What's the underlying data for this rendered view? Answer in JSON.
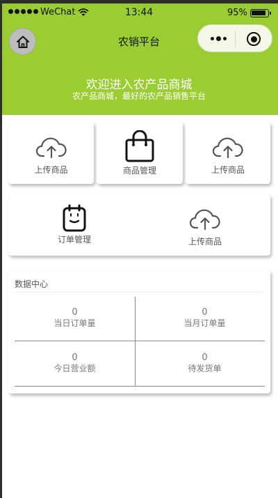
{
  "status_bar": {
    "carrier": "WeChat",
    "time": "13:44",
    "battery": "95%"
  },
  "nav": {
    "title": "农销平台"
  },
  "banner": {
    "title": "欢迎进入农产品商城",
    "subtitle": "农产品商城，最好的农产品销售平台"
  },
  "menu_row1": [
    {
      "label": "上传商品",
      "icon": "upload-cloud-icon"
    },
    {
      "label": "商品管理",
      "icon": "shopping-bag-icon"
    },
    {
      "label": "上传商品",
      "icon": "upload-cloud-icon"
    }
  ],
  "menu_row2": [
    {
      "label": "订单管理",
      "icon": "clipboard-icon"
    },
    {
      "label": "上传商品",
      "icon": "upload-cloud-icon"
    }
  ],
  "data_center": {
    "title": "数据中心",
    "stats": [
      {
        "value": "0",
        "label": "当日订单量"
      },
      {
        "value": "0",
        "label": "当月订单量"
      },
      {
        "value": "0",
        "label": "今日营业额"
      },
      {
        "value": "0",
        "label": "待发货单"
      }
    ]
  },
  "colors": {
    "accent": "#9acd32",
    "text_muted": "#777777"
  }
}
